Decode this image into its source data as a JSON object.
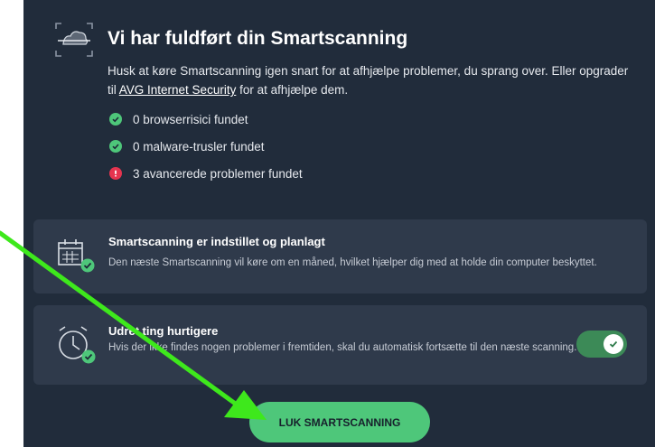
{
  "header": {
    "title": "Vi har fuldført din Smartscanning",
    "description_before": "Husk at køre Smartscanning igen snart for at afhjælpe problemer, du sprang over. Eller opgrader til ",
    "upgrade_link": "AVG Internet Security",
    "description_after": " for at afhjælpe dem."
  },
  "results": [
    {
      "label": "0 browserrisici fundet",
      "status": "ok"
    },
    {
      "label": "0 malware-trusler fundet",
      "status": "ok"
    },
    {
      "label": "3 avancerede problemer fundet",
      "status": "warning"
    }
  ],
  "schedule_card": {
    "title": "Smartscanning er indstillet og planlagt",
    "text": "Den næste Smartscanning vil køre om en måned, hvilket hjælper dig med at holde din computer beskyttet."
  },
  "auto_card": {
    "title": "Udret ting hurtigere",
    "text": "Hvis der ikke findes nogen problemer i fremtiden, skal du automatisk fortsætte til den næste scanning.",
    "toggle_on": true
  },
  "close_button": "LUK SMARTSCANNING",
  "colors": {
    "background": "#212c3b",
    "card": "#2f3a4b",
    "accent_green": "#4ec77a",
    "warning_red": "#e5344f",
    "annotation_arrow": "#3ee81c"
  }
}
